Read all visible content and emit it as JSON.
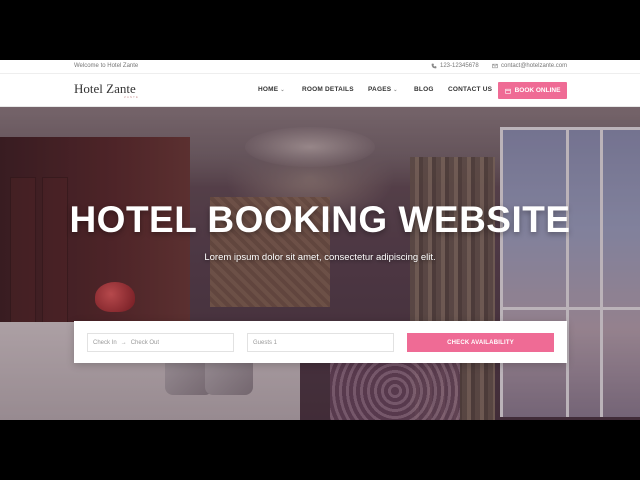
{
  "topbar": {
    "welcome": "Welcome to Hotel Zante",
    "phone": "123-12345678",
    "email": "contact@hotelzante.com"
  },
  "navbar": {
    "logo": "Hotel Zante",
    "logo_sub": "ZANTE",
    "items": [
      {
        "label": "HOME",
        "dropdown": true
      },
      {
        "label": "ROOM DETAILS",
        "dropdown": false
      },
      {
        "label": "PAGES",
        "dropdown": true
      },
      {
        "label": "BLOG",
        "dropdown": false
      },
      {
        "label": "CONTACT US",
        "dropdown": false
      }
    ],
    "book_label": "BOOK ONLINE"
  },
  "hero": {
    "title": "HOTEL BOOKING WEBSITE",
    "subtitle": "Lorem ipsum dolor sit amet, consectetur adipiscing elit."
  },
  "booking": {
    "check_in": "Check In",
    "arrow": "→",
    "check_out": "Check Out",
    "guests_value": "Guests 1",
    "button_label": "CHECK AVAILABILITY"
  },
  "colors": {
    "accent": "#ef6b95",
    "text_dark": "#333333"
  },
  "icons": {
    "phone": "phone-icon",
    "mail": "mail-icon",
    "calendar": "calendar-icon",
    "chevron": "chevron-down-icon"
  }
}
